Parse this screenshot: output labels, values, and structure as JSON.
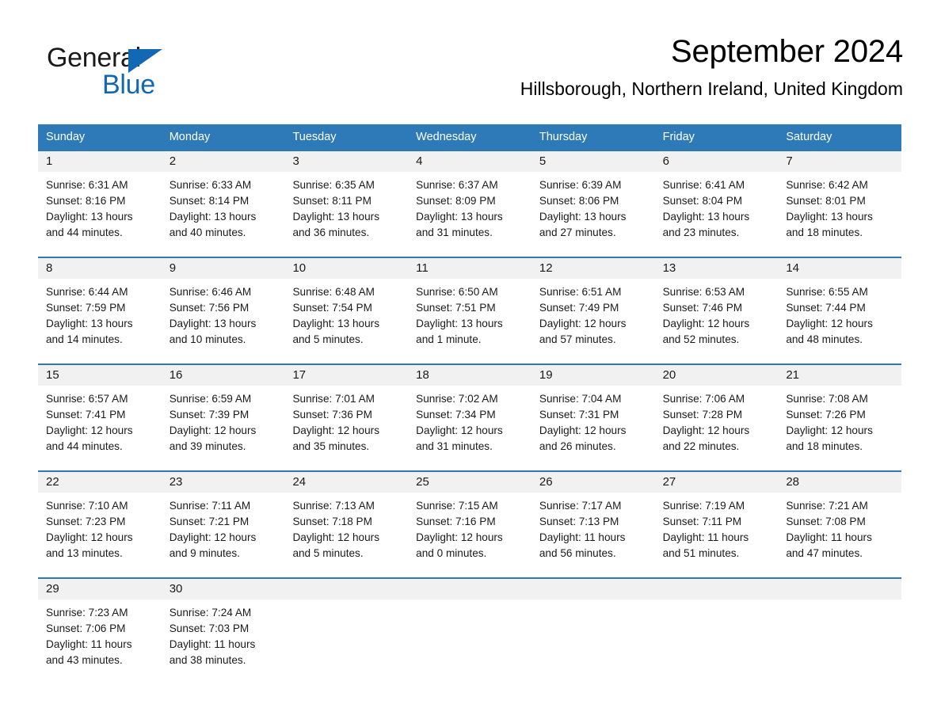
{
  "brand": {
    "name_part1": "General",
    "name_part2": "Blue",
    "triangle_color": "#1268b3",
    "accent_color": "#2e7ab8"
  },
  "header": {
    "month_title": "September 2024",
    "location": "Hillsborough, Northern Ireland, United Kingdom"
  },
  "calendar": {
    "weekdays": [
      "Sunday",
      "Monday",
      "Tuesday",
      "Wednesday",
      "Thursday",
      "Friday",
      "Saturday"
    ],
    "weeks": [
      {
        "days": [
          {
            "num": "1",
            "lines": [
              "Sunrise: 6:31 AM",
              "Sunset: 8:16 PM",
              "Daylight: 13 hours",
              "and 44 minutes."
            ]
          },
          {
            "num": "2",
            "lines": [
              "Sunrise: 6:33 AM",
              "Sunset: 8:14 PM",
              "Daylight: 13 hours",
              "and 40 minutes."
            ]
          },
          {
            "num": "3",
            "lines": [
              "Sunrise: 6:35 AM",
              "Sunset: 8:11 PM",
              "Daylight: 13 hours",
              "and 36 minutes."
            ]
          },
          {
            "num": "4",
            "lines": [
              "Sunrise: 6:37 AM",
              "Sunset: 8:09 PM",
              "Daylight: 13 hours",
              "and 31 minutes."
            ]
          },
          {
            "num": "5",
            "lines": [
              "Sunrise: 6:39 AM",
              "Sunset: 8:06 PM",
              "Daylight: 13 hours",
              "and 27 minutes."
            ]
          },
          {
            "num": "6",
            "lines": [
              "Sunrise: 6:41 AM",
              "Sunset: 8:04 PM",
              "Daylight: 13 hours",
              "and 23 minutes."
            ]
          },
          {
            "num": "7",
            "lines": [
              "Sunrise: 6:42 AM",
              "Sunset: 8:01 PM",
              "Daylight: 13 hours",
              "and 18 minutes."
            ]
          }
        ]
      },
      {
        "days": [
          {
            "num": "8",
            "lines": [
              "Sunrise: 6:44 AM",
              "Sunset: 7:59 PM",
              "Daylight: 13 hours",
              "and 14 minutes."
            ]
          },
          {
            "num": "9",
            "lines": [
              "Sunrise: 6:46 AM",
              "Sunset: 7:56 PM",
              "Daylight: 13 hours",
              "and 10 minutes."
            ]
          },
          {
            "num": "10",
            "lines": [
              "Sunrise: 6:48 AM",
              "Sunset: 7:54 PM",
              "Daylight: 13 hours",
              "and 5 minutes."
            ]
          },
          {
            "num": "11",
            "lines": [
              "Sunrise: 6:50 AM",
              "Sunset: 7:51 PM",
              "Daylight: 13 hours",
              "and 1 minute."
            ]
          },
          {
            "num": "12",
            "lines": [
              "Sunrise: 6:51 AM",
              "Sunset: 7:49 PM",
              "Daylight: 12 hours",
              "and 57 minutes."
            ]
          },
          {
            "num": "13",
            "lines": [
              "Sunrise: 6:53 AM",
              "Sunset: 7:46 PM",
              "Daylight: 12 hours",
              "and 52 minutes."
            ]
          },
          {
            "num": "14",
            "lines": [
              "Sunrise: 6:55 AM",
              "Sunset: 7:44 PM",
              "Daylight: 12 hours",
              "and 48 minutes."
            ]
          }
        ]
      },
      {
        "days": [
          {
            "num": "15",
            "lines": [
              "Sunrise: 6:57 AM",
              "Sunset: 7:41 PM",
              "Daylight: 12 hours",
              "and 44 minutes."
            ]
          },
          {
            "num": "16",
            "lines": [
              "Sunrise: 6:59 AM",
              "Sunset: 7:39 PM",
              "Daylight: 12 hours",
              "and 39 minutes."
            ]
          },
          {
            "num": "17",
            "lines": [
              "Sunrise: 7:01 AM",
              "Sunset: 7:36 PM",
              "Daylight: 12 hours",
              "and 35 minutes."
            ]
          },
          {
            "num": "18",
            "lines": [
              "Sunrise: 7:02 AM",
              "Sunset: 7:34 PM",
              "Daylight: 12 hours",
              "and 31 minutes."
            ]
          },
          {
            "num": "19",
            "lines": [
              "Sunrise: 7:04 AM",
              "Sunset: 7:31 PM",
              "Daylight: 12 hours",
              "and 26 minutes."
            ]
          },
          {
            "num": "20",
            "lines": [
              "Sunrise: 7:06 AM",
              "Sunset: 7:28 PM",
              "Daylight: 12 hours",
              "and 22 minutes."
            ]
          },
          {
            "num": "21",
            "lines": [
              "Sunrise: 7:08 AM",
              "Sunset: 7:26 PM",
              "Daylight: 12 hours",
              "and 18 minutes."
            ]
          }
        ]
      },
      {
        "days": [
          {
            "num": "22",
            "lines": [
              "Sunrise: 7:10 AM",
              "Sunset: 7:23 PM",
              "Daylight: 12 hours",
              "and 13 minutes."
            ]
          },
          {
            "num": "23",
            "lines": [
              "Sunrise: 7:11 AM",
              "Sunset: 7:21 PM",
              "Daylight: 12 hours",
              "and 9 minutes."
            ]
          },
          {
            "num": "24",
            "lines": [
              "Sunrise: 7:13 AM",
              "Sunset: 7:18 PM",
              "Daylight: 12 hours",
              "and 5 minutes."
            ]
          },
          {
            "num": "25",
            "lines": [
              "Sunrise: 7:15 AM",
              "Sunset: 7:16 PM",
              "Daylight: 12 hours",
              "and 0 minutes."
            ]
          },
          {
            "num": "26",
            "lines": [
              "Sunrise: 7:17 AM",
              "Sunset: 7:13 PM",
              "Daylight: 11 hours",
              "and 56 minutes."
            ]
          },
          {
            "num": "27",
            "lines": [
              "Sunrise: 7:19 AM",
              "Sunset: 7:11 PM",
              "Daylight: 11 hours",
              "and 51 minutes."
            ]
          },
          {
            "num": "28",
            "lines": [
              "Sunrise: 7:21 AM",
              "Sunset: 7:08 PM",
              "Daylight: 11 hours",
              "and 47 minutes."
            ]
          }
        ]
      },
      {
        "days": [
          {
            "num": "29",
            "lines": [
              "Sunrise: 7:23 AM",
              "Sunset: 7:06 PM",
              "Daylight: 11 hours",
              "and 43 minutes."
            ]
          },
          {
            "num": "30",
            "lines": [
              "Sunrise: 7:24 AM",
              "Sunset: 7:03 PM",
              "Daylight: 11 hours",
              "and 38 minutes."
            ]
          },
          {
            "num": "",
            "lines": []
          },
          {
            "num": "",
            "lines": []
          },
          {
            "num": "",
            "lines": []
          },
          {
            "num": "",
            "lines": []
          },
          {
            "num": "",
            "lines": []
          }
        ]
      }
    ]
  }
}
